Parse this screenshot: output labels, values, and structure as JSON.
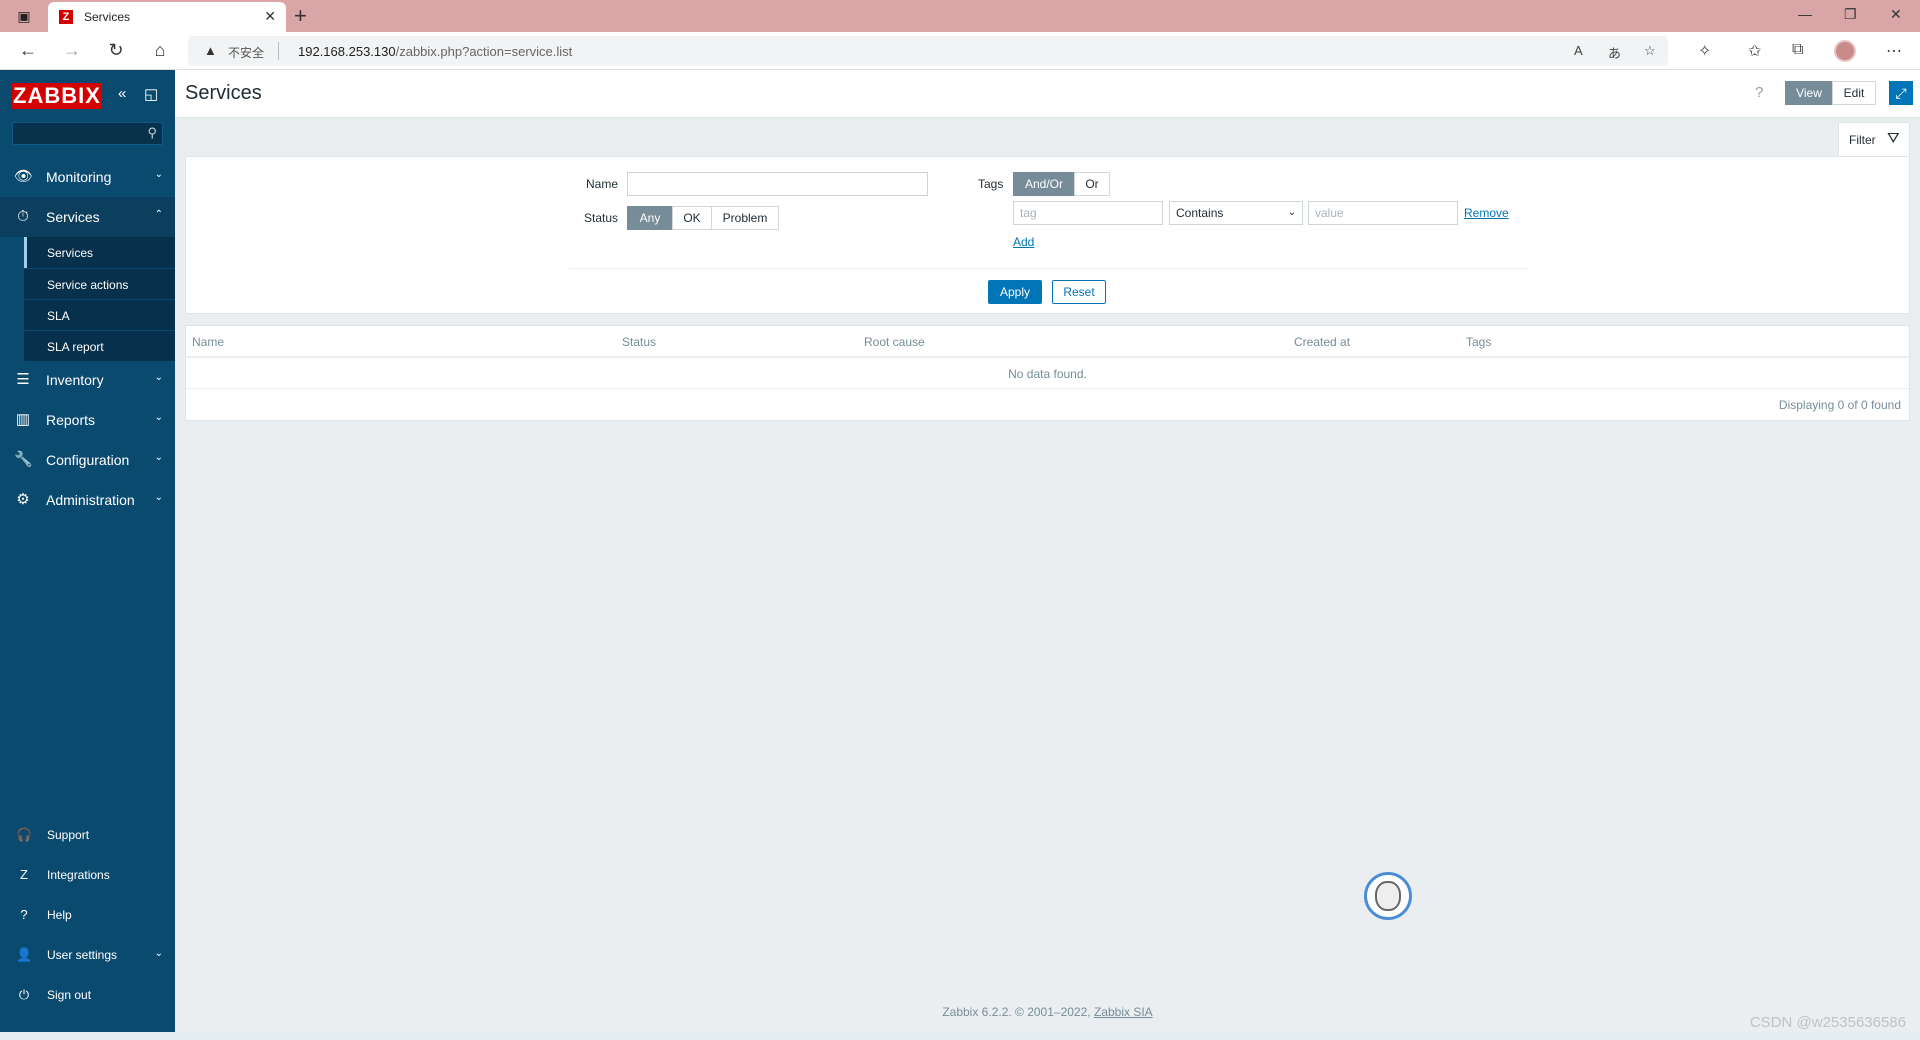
{
  "browser": {
    "tab_title": "Services",
    "tab_favicon": "Z",
    "address_warning": "不安全",
    "url_host": "192.168.253.130",
    "url_path": "/zabbix.php?action=service.list"
  },
  "sidebar": {
    "logo": "ZABBIX",
    "search_value": "",
    "menu": [
      {
        "label": "Monitoring",
        "icon": "eye-icon",
        "glyph": "👁"
      },
      {
        "label": "Services",
        "icon": "services-icon",
        "glyph": "⏱"
      },
      {
        "label": "Inventory",
        "icon": "list-icon",
        "glyph": "☰"
      },
      {
        "label": "Reports",
        "icon": "bar-chart-icon",
        "glyph": "▥"
      },
      {
        "label": "Configuration",
        "icon": "wrench-icon",
        "glyph": "🔧"
      },
      {
        "label": "Administration",
        "icon": "gear-icon",
        "glyph": "⚙"
      }
    ],
    "submenu": [
      {
        "label": "Services"
      },
      {
        "label": "Service actions"
      },
      {
        "label": "SLA"
      },
      {
        "label": "SLA report"
      }
    ],
    "bottom": [
      {
        "label": "Support",
        "icon": "headset-icon",
        "glyph": "🎧"
      },
      {
        "label": "Integrations",
        "icon": "integrations-icon",
        "glyph": "Z"
      },
      {
        "label": "Help",
        "icon": "help-icon",
        "glyph": "?"
      },
      {
        "label": "User settings",
        "icon": "user-icon",
        "glyph": "👤"
      },
      {
        "label": "Sign out",
        "icon": "power-icon",
        "glyph": "⏻"
      }
    ]
  },
  "header": {
    "title": "Services",
    "help": "?",
    "view_label": "View",
    "edit_label": "Edit"
  },
  "filter": {
    "tab_label": "Filter",
    "name_label": "Name",
    "name_value": "",
    "status_label": "Status",
    "status_options": [
      "Any",
      "OK",
      "Problem"
    ],
    "status_selected": "Any",
    "tags_label": "Tags",
    "tags_mode_options": [
      "And/Or",
      "Or"
    ],
    "tags_mode_selected": "And/Or",
    "tag_placeholder": "tag",
    "operator_value": "Contains",
    "value_placeholder": "value",
    "remove_label": "Remove",
    "add_label": "Add",
    "apply_label": "Apply",
    "reset_label": "Reset"
  },
  "table": {
    "columns": [
      "Name",
      "Status",
      "Root cause",
      "Created at",
      "Tags"
    ],
    "empty_text": "No data found.",
    "paging_text": "Displaying 0 of 0 found"
  },
  "footer": {
    "text": "Zabbix 6.2.2. © 2001–2022,",
    "link": "Zabbix SIA"
  },
  "watermark": "CSDN @w2535636586",
  "colors": {
    "sidebar_bg": "#0b4a6f",
    "accent": "#0275b8",
    "logo_red": "#d40000",
    "tabbar": "#d9a5a7"
  }
}
